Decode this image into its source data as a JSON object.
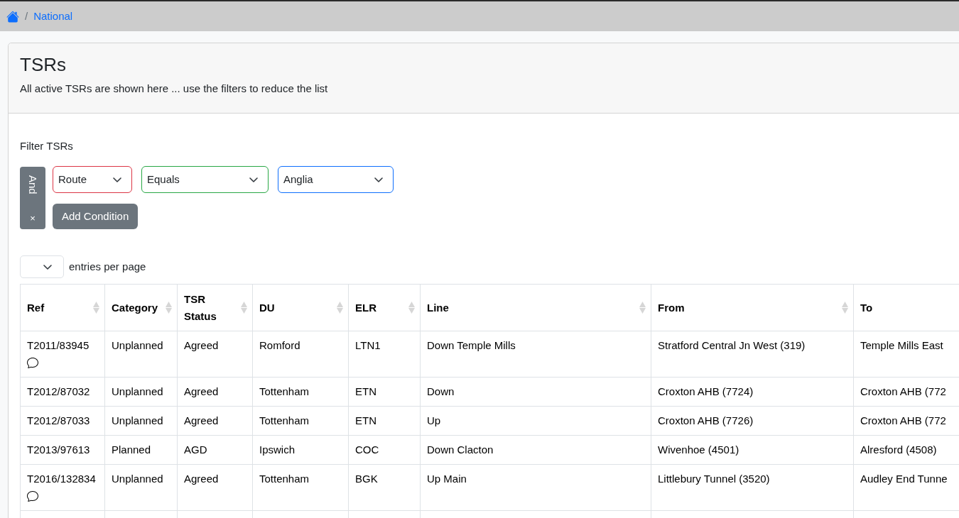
{
  "breadcrumb": {
    "separator": "/",
    "items": [
      {
        "label": "National"
      }
    ]
  },
  "card": {
    "title": "TSRs",
    "subtitle": "All active TSRs are shown here ... use the filters to reduce the list"
  },
  "filter": {
    "label": "Filter TSRs",
    "group": {
      "operator": "And",
      "remove": "×"
    },
    "conditions": [
      {
        "value": "Route",
        "color": "#dc3545"
      },
      {
        "value": "Equals",
        "color": "#28a745"
      },
      {
        "value": "Anglia",
        "color": "#0d6efd"
      }
    ],
    "add_button": "Add Condition"
  },
  "page_size": {
    "label": "entries per page"
  },
  "table": {
    "columns": [
      {
        "label": "Ref",
        "sortable": true
      },
      {
        "label": "Category",
        "sortable": true
      },
      {
        "label": "TSR Status",
        "sortable": true
      },
      {
        "label": "DU",
        "sortable": true
      },
      {
        "label": "ELR",
        "sortable": true
      },
      {
        "label": "Line",
        "sortable": true
      },
      {
        "label": "From",
        "sortable": true
      },
      {
        "label": "To",
        "sortable": false
      }
    ],
    "rows": [
      {
        "cells": [
          "T2011/83945",
          "Unplanned",
          "Agreed",
          "Romford",
          "LTN1",
          "Down Temple Mills",
          "Stratford Central Jn West (319)",
          "Temple Mills East"
        ],
        "comment": true
      },
      {
        "cells": [
          "T2012/87032",
          "Unplanned",
          "Agreed",
          "Tottenham",
          "ETN",
          "Down",
          "Croxton AHB (7724)",
          "Croxton AHB (772"
        ],
        "comment": false
      },
      {
        "cells": [
          "T2012/87033",
          "Unplanned",
          "Agreed",
          "Tottenham",
          "ETN",
          "Up",
          "Croxton AHB (7726)",
          "Croxton AHB (772"
        ],
        "comment": false
      },
      {
        "cells": [
          "T2013/97613",
          "Planned",
          "AGD",
          "Ipswich",
          "COC",
          "Down Clacton",
          "Wivenhoe (4501)",
          "Alresford (4508)"
        ],
        "comment": false
      },
      {
        "cells": [
          "T2016/132834",
          "Unplanned",
          "Agreed",
          "Tottenham",
          "BGK",
          "Up Main",
          "Littlebury Tunnel (3520)",
          "Audley End Tunne"
        ],
        "comment": true
      }
    ]
  }
}
